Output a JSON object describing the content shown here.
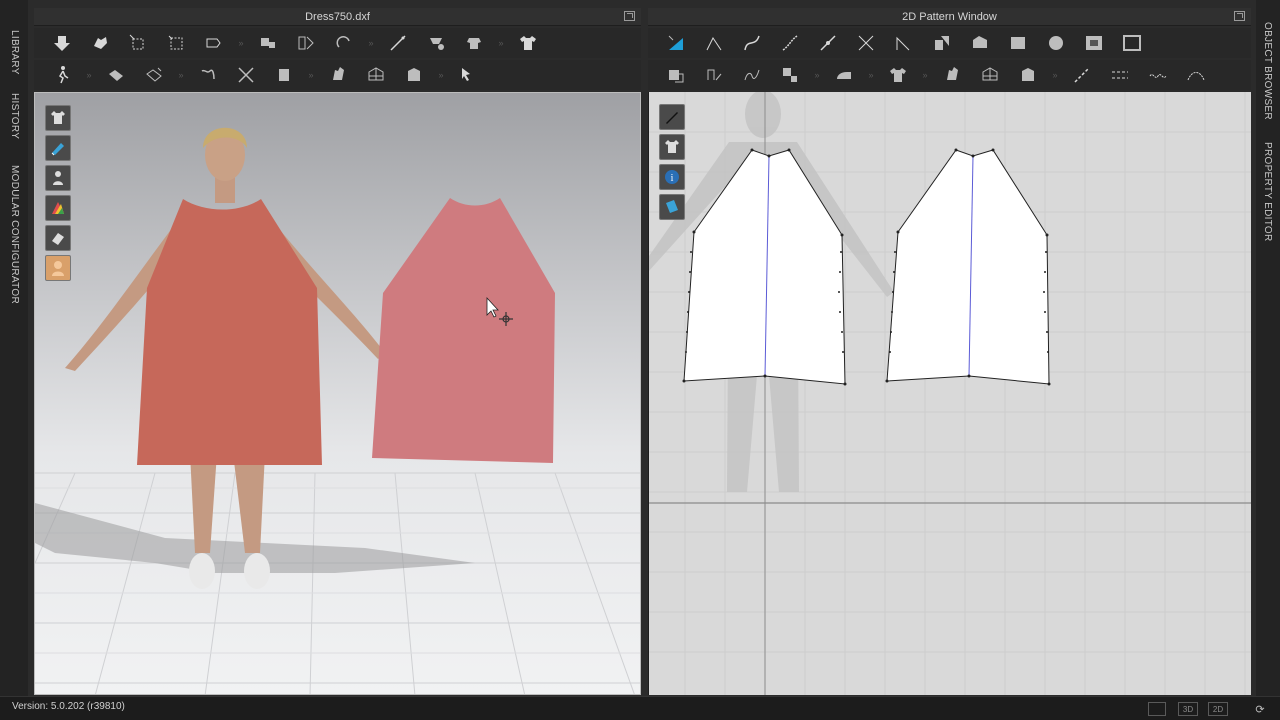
{
  "window": {
    "left_panel_title": "Dress750.dxf",
    "right_panel_title": "2D Pattern Window"
  },
  "left_sidebar": {
    "tabs": [
      {
        "label": "LIBRARY"
      },
      {
        "label": "HISTORY"
      },
      {
        "label": "MODULAR CONFIGURATOR"
      }
    ]
  },
  "right_sidebar": {
    "tabs": [
      {
        "label": "OBJECT BROWSER"
      },
      {
        "label": "PROPERTY EDITOR"
      }
    ]
  },
  "viewport3d": {
    "side_tools": [
      {
        "icon": "garment-visibility-icon"
      },
      {
        "icon": "fabric-visibility-icon"
      },
      {
        "icon": "avatar-visibility-icon"
      },
      {
        "icon": "texture-display-icon"
      },
      {
        "icon": "render-mode-icon"
      },
      {
        "icon": "avatar-skin-icon"
      }
    ],
    "garment_color": "#c6685a",
    "garment_back_color": "#cf7b7f"
  },
  "viewport2d": {
    "side_tools": [
      {
        "icon": "pen-visibility-icon"
      },
      {
        "icon": "pattern-visibility-icon"
      },
      {
        "icon": "info-icon"
      },
      {
        "icon": "texture-2d-icon"
      }
    ]
  },
  "statusbar": {
    "version": "Version: 5.0.202 (r39810)",
    "view_3d": "3D",
    "view_2d": "2D"
  },
  "colors": {
    "accent": "#1e9fd8",
    "ui_bg": "#2b2b2b"
  }
}
